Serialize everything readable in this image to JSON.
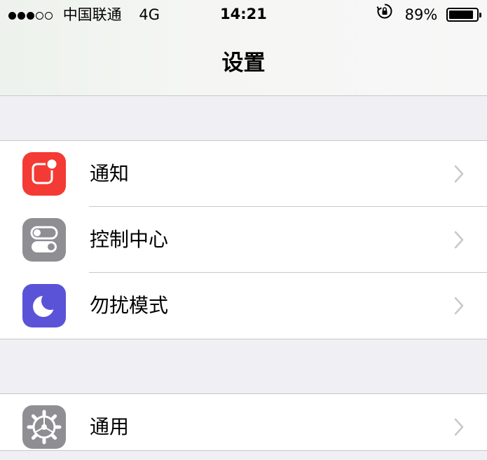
{
  "status_bar": {
    "carrier": "中国联通",
    "network": "4G",
    "time": "14:21",
    "battery_percent": "89%",
    "battery_level": 0.89,
    "signal_bars_filled": 3,
    "signal_bars_total": 5
  },
  "nav": {
    "title": "设置"
  },
  "groups": [
    {
      "items": [
        {
          "label": "通知",
          "icon": "notifications-icon",
          "color": "#f43a34"
        },
        {
          "label": "控制中心",
          "icon": "control-center-icon",
          "color": "#8e8e93"
        },
        {
          "label": "勿扰模式",
          "icon": "moon-icon",
          "color": "#5a53d8"
        }
      ]
    },
    {
      "items": [
        {
          "label": "通用",
          "icon": "gear-icon",
          "color": "#8e8e93"
        }
      ]
    }
  ]
}
